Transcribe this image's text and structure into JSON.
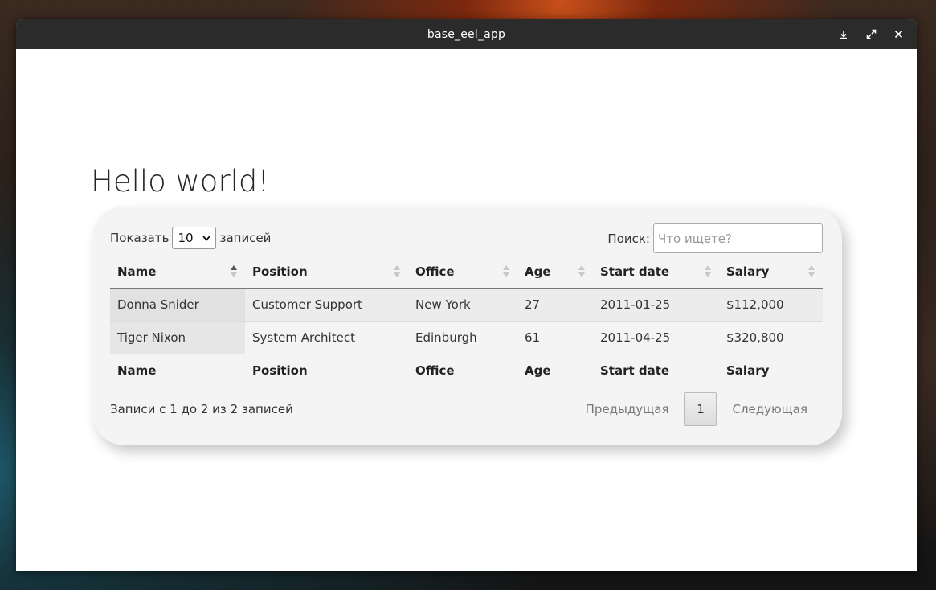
{
  "window": {
    "title": "base_eel_app"
  },
  "page": {
    "heading": "Hello world!"
  },
  "datatable": {
    "length": {
      "prefix": "Показать",
      "value": "10",
      "suffix": "записей"
    },
    "search": {
      "label": "Поиск:",
      "placeholder": "Что ищете?"
    },
    "columns": [
      "Name",
      "Position",
      "Office",
      "Age",
      "Start date",
      "Salary"
    ],
    "sorted_column": "Name",
    "sort_direction": "ascending",
    "rows": [
      [
        "Donna Snider",
        "Customer Support",
        "New York",
        "27",
        "2011-01-25",
        "$112,000"
      ],
      [
        "Tiger Nixon",
        "System Architect",
        "Edinburgh",
        "61",
        "2011-04-25",
        "$320,800"
      ]
    ],
    "info": "Записи с 1 до 2 из 2 записей",
    "pagination": {
      "previous": "Предыдущая",
      "current": "1",
      "next": "Следующая"
    }
  }
}
